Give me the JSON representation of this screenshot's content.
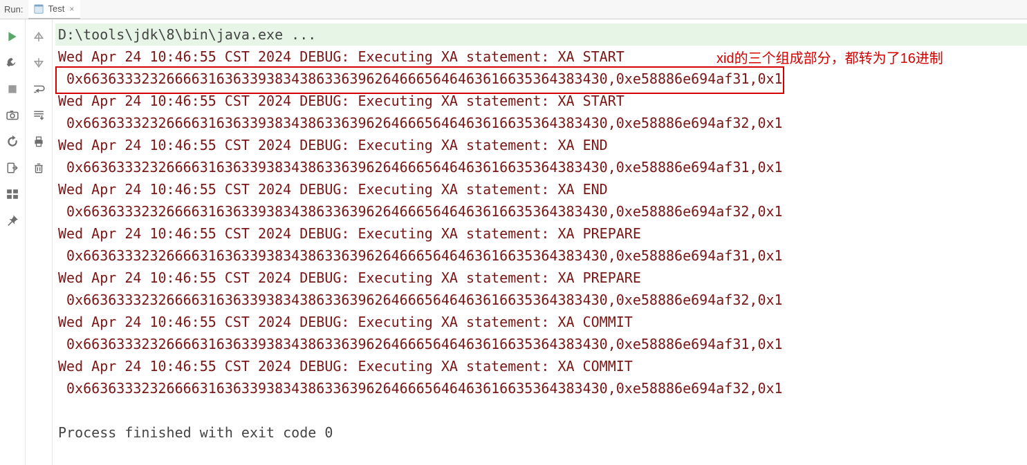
{
  "header": {
    "runLabel": "Run:",
    "tabLabel": "Test",
    "closeGlyph": "×"
  },
  "console": {
    "cmd": "D:\\tools\\jdk\\8\\bin\\java.exe ...",
    "lines": [
      "Wed Apr 24 10:46:55 CST 2024 DEBUG: Executing XA statement: XA START",
      " 0x663633323266663163633938343863363962646665646463616635364383430,0xe58886e694af31,0x1",
      "Wed Apr 24 10:46:55 CST 2024 DEBUG: Executing XA statement: XA START",
      " 0x663633323266663163633938343863363962646665646463616635364383430,0xe58886e694af32,0x1",
      "Wed Apr 24 10:46:55 CST 2024 DEBUG: Executing XA statement: XA END",
      " 0x663633323266663163633938343863363962646665646463616635364383430,0xe58886e694af31,0x1",
      "Wed Apr 24 10:46:55 CST 2024 DEBUG: Executing XA statement: XA END",
      " 0x663633323266663163633938343863363962646665646463616635364383430,0xe58886e694af32,0x1",
      "Wed Apr 24 10:46:55 CST 2024 DEBUG: Executing XA statement: XA PREPARE",
      " 0x663633323266663163633938343863363962646665646463616635364383430,0xe58886e694af31,0x1",
      "Wed Apr 24 10:46:55 CST 2024 DEBUG: Executing XA statement: XA PREPARE",
      " 0x663633323266663163633938343863363962646665646463616635364383430,0xe58886e694af32,0x1",
      "Wed Apr 24 10:46:55 CST 2024 DEBUG: Executing XA statement: XA COMMIT",
      " 0x663633323266663163633938343863363962646665646463616635364383430,0xe58886e694af31,0x1",
      "Wed Apr 24 10:46:55 CST 2024 DEBUG: Executing XA statement: XA COMMIT",
      " 0x663633323266663163633938343863363962646665646463616635364383430,0xe58886e694af32,0x1"
    ],
    "exit": "Process finished with exit code 0"
  },
  "annotation": {
    "text": "xid的三个组成部分，都转为了16进制"
  }
}
